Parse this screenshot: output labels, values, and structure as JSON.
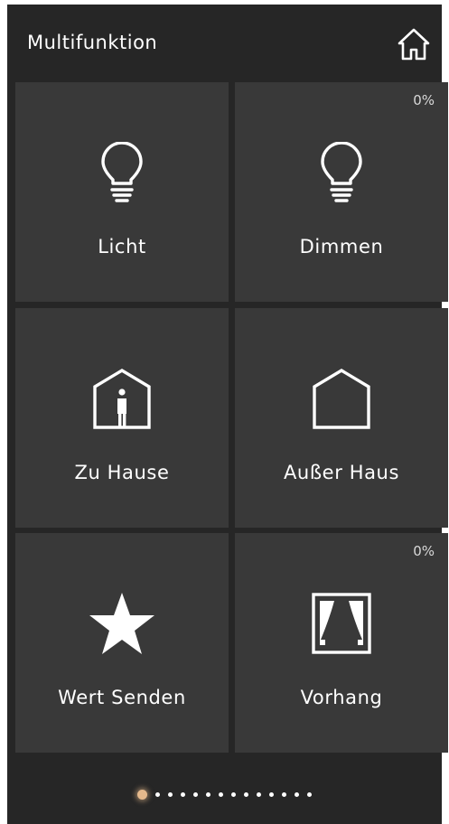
{
  "header": {
    "title": "Multifunktion",
    "home_icon": "home-icon"
  },
  "tiles": [
    {
      "label": "Licht",
      "icon": "lightbulb-icon",
      "percent": ""
    },
    {
      "label": "Dimmen",
      "icon": "lightbulb-icon",
      "percent": "0%"
    },
    {
      "label": "Zu Hause",
      "icon": "house-person-icon",
      "percent": ""
    },
    {
      "label": "Außer Haus",
      "icon": "house-empty-icon",
      "percent": ""
    },
    {
      "label": "Wert Senden",
      "icon": "star-icon",
      "percent": ""
    },
    {
      "label": "Vorhang",
      "icon": "curtain-icon",
      "percent": "0%"
    }
  ],
  "pager": {
    "page_count": 14,
    "active_page": 1,
    "active_color": "#e5b98c"
  },
  "colors": {
    "background": "#262626",
    "tile": "#393939",
    "text": "#ffffff"
  }
}
